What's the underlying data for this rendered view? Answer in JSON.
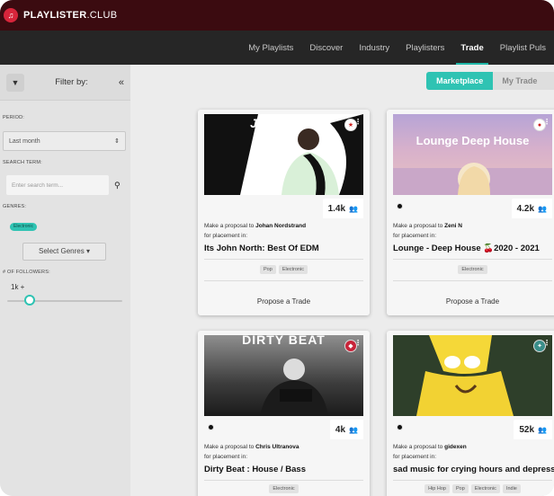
{
  "brand": {
    "name_bold": "PLAYLISTER",
    "name_rest": ".CLUB"
  },
  "nav": {
    "items": [
      {
        "label": "My Playlists"
      },
      {
        "label": "Discover"
      },
      {
        "label": "Industry"
      },
      {
        "label": "Playlisters"
      },
      {
        "label": "Trade",
        "active": true
      },
      {
        "label": "Playlist Puls"
      }
    ]
  },
  "sidebar": {
    "filter_by": "Filter by:",
    "period_label": "PERIOD:",
    "period_value": "Last month",
    "search_label": "SEARCH TERM:",
    "search_placeholder": "Enter search term...",
    "genres_label": "GENRES:",
    "selected_genre": "Electronic",
    "select_genres": "Select Genres",
    "followers_label": "# OF FOLLOWERS:",
    "followers_value": "1k +"
  },
  "segment": {
    "marketplace": "Marketplace",
    "my_trade": "My Trade"
  },
  "cards": [
    {
      "art_text": "John North",
      "followers": "1.4k",
      "proposal_prefix": "Make a proposal to",
      "owner": "Johan Nordstrand",
      "placement": "for placement in:",
      "title": "Its John North: Best Of EDM",
      "tags": [
        "Pop",
        "Electronic"
      ],
      "action": "Propose a Trade"
    },
    {
      "art_text": "Lounge Deep House",
      "followers": "4.2k",
      "proposal_prefix": "Make a proposal to",
      "owner": "Zeni N",
      "placement": "for placement in:",
      "title": "Lounge - Deep House 🍒2020 - 2021",
      "tags": [
        "Electronic"
      ],
      "action": "Propose a Trade"
    },
    {
      "art_text": "DIRTY BEAT",
      "followers": "4k",
      "proposal_prefix": "Make a proposal to",
      "owner": "Chris Ultranova",
      "placement": "for placement in:",
      "title": "Dirty Beat : House / Bass",
      "tags": [
        "Electronic"
      ],
      "action": "Propose a Trade"
    },
    {
      "art_text": "",
      "followers": "52k",
      "proposal_prefix": "Make a proposal to",
      "owner": "gidexen",
      "placement": "for placement in:",
      "title": "sad music for crying hours and depress...",
      "tags": [
        "Hip Hop",
        "Pop",
        "Electronic",
        "Indie"
      ],
      "action": "Propose a Trade"
    }
  ],
  "colors": {
    "accent": "#2fc3b3",
    "brand_bar": "#3b0b10",
    "nav_bg": "#262626",
    "logo": "#d8253b"
  }
}
